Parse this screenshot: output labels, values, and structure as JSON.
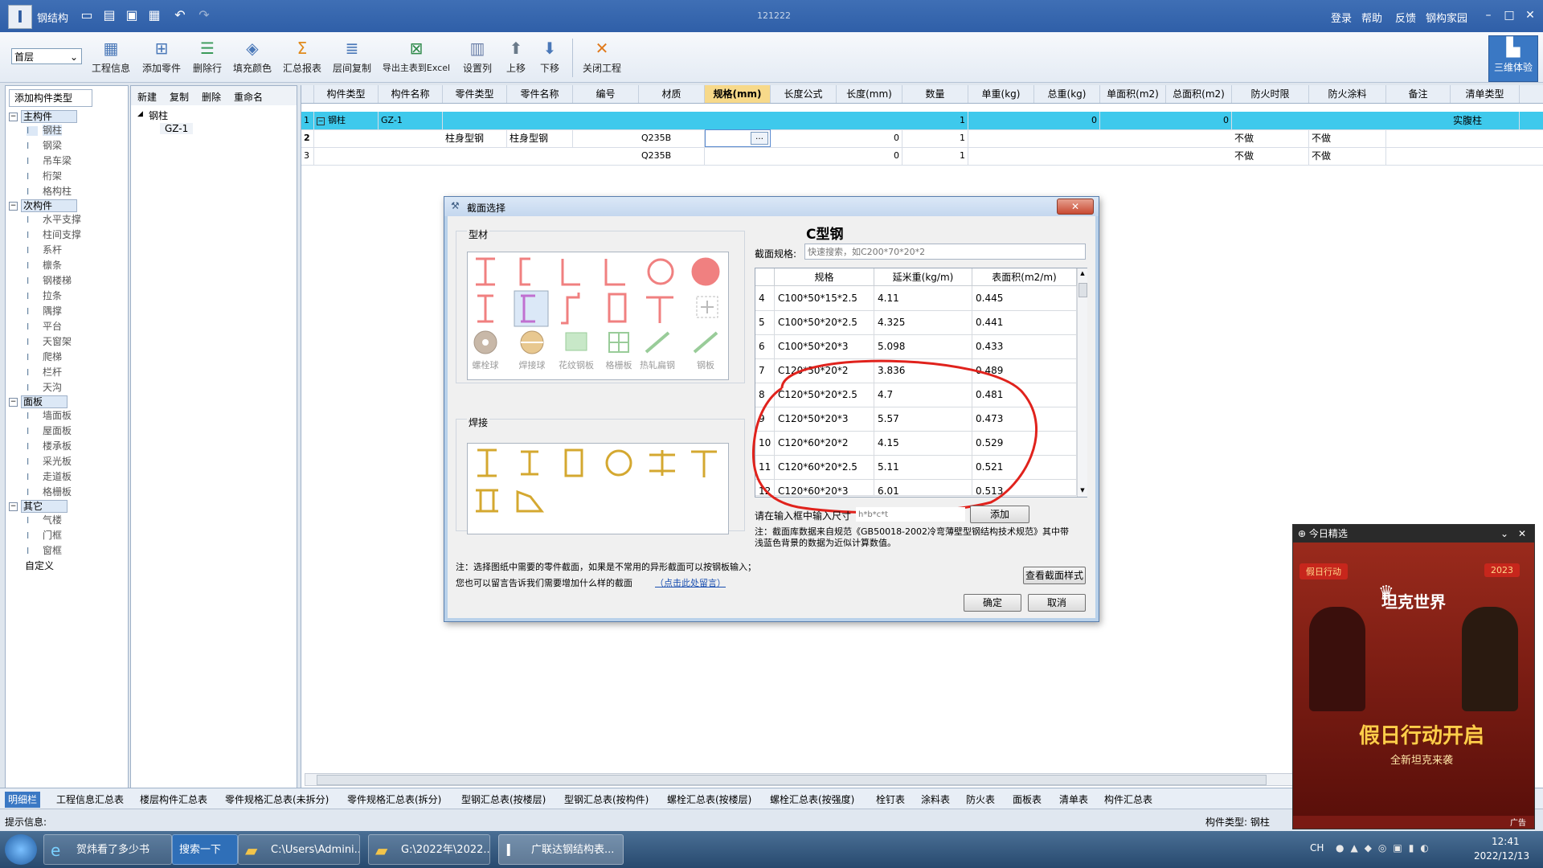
{
  "window": {
    "app_title": "钢结构",
    "center_title": "121222",
    "menu": [
      "登录",
      "帮助",
      "反馈",
      "钢构家园"
    ]
  },
  "ribbon": {
    "floor_select": "首层",
    "buttons": [
      "工程信息",
      "添加零件",
      "删除行",
      "填充颜色",
      "汇总报表",
      "层间复制",
      "导出主表到Excel",
      "设置列",
      "上移",
      "下移",
      "关闭工程"
    ],
    "btn_3d": "三维体验"
  },
  "left_panel": {
    "header": "添加构件类型",
    "groups": [
      {
        "label": "主构件",
        "items": [
          "钢柱",
          "钢梁",
          "吊车梁",
          "桁架",
          "格构柱"
        ]
      },
      {
        "label": "次构件",
        "items": [
          "水平支撑",
          "柱间支撑",
          "系杆",
          "檩条",
          "钢楼梯",
          "拉条",
          "隅撑",
          "平台",
          "天窗架",
          "爬梯",
          "栏杆",
          "天沟"
        ]
      },
      {
        "label": "面板",
        "items": [
          "墙面板",
          "屋面板",
          "楼承板",
          "采光板",
          "走道板",
          "格栅板"
        ]
      },
      {
        "label": "其它",
        "items": [
          "气楼",
          "门框",
          "窗框"
        ]
      }
    ],
    "custom": "自定义"
  },
  "mid_panel": {
    "tools": [
      "新建",
      "复制",
      "删除",
      "重命名"
    ],
    "tree_root": "钢柱",
    "tree_child": "GZ-1"
  },
  "grid": {
    "headers": [
      "构件类型",
      "构件名称",
      "零件类型",
      "零件名称",
      "编号",
      "材质",
      "规格(mm)",
      "长度公式",
      "长度(mm)",
      "数量",
      "单重(kg)",
      "总重(kg)",
      "单面积(m2)",
      "总面积(m2)",
      "防火时限",
      "防火涂料",
      "备注",
      "清单类型"
    ],
    "rows": [
      [
        "1",
        "钢柱",
        "GZ-1",
        "",
        "",
        "",
        "",
        "",
        "",
        "",
        "1",
        "",
        "0",
        "",
        "0",
        "",
        "",
        "",
        "实腹柱"
      ],
      [
        "2",
        "",
        "",
        "柱身型钢",
        "柱身型钢",
        "",
        "Q235B",
        "…",
        "",
        "0",
        "1",
        "",
        "",
        "",
        "",
        "不做",
        "不做",
        "",
        ""
      ],
      [
        "3",
        "",
        "",
        "",
        "",
        "",
        "Q235B",
        "",
        "",
        "0",
        "1",
        "",
        "",
        "",
        "",
        "不做",
        "不做",
        "",
        ""
      ]
    ]
  },
  "dialog": {
    "title": "截面选择",
    "group_profiles": "型材",
    "profile_labels": [
      "螺栓球",
      "焊接球",
      "花纹钢板",
      "格栅板",
      "热轧扁钢",
      "钢板"
    ],
    "group_welded": "焊接",
    "heading": "C型钢",
    "spec_label": "截面规格:",
    "search_placeholder": "快速搜索，如C200*70*20*2",
    "table_headers": [
      "规格",
      "延米重(kg/m)",
      "表面积(m2/m)"
    ],
    "table_rows": [
      [
        "4",
        "C100*50*15*2.5",
        "4.11",
        "0.445"
      ],
      [
        "5",
        "C100*50*20*2.5",
        "4.325",
        "0.441"
      ],
      [
        "6",
        "C100*50*20*3",
        "5.098",
        "0.433"
      ],
      [
        "7",
        "C120*50*20*2",
        "3.836",
        "0.489"
      ],
      [
        "8",
        "C120*50*20*2.5",
        "4.7",
        "0.481"
      ],
      [
        "9",
        "C120*50*20*3",
        "5.57",
        "0.473"
      ],
      [
        "10",
        "C120*60*20*2",
        "4.15",
        "0.529"
      ],
      [
        "11",
        "C120*60*20*2.5",
        "5.11",
        "0.521"
      ],
      [
        "12",
        "C120*60*20*3",
        "6.01",
        "0.513"
      ]
    ],
    "input_label": "请在输入框中输入尺寸",
    "input_placeholder": "h*b*c*t",
    "add_button": "添加",
    "note_right": "注：截面库数据来自规范《GB50018-2002冷弯薄壁型钢结构技术规范》其中带浅蓝色背景的数据为近似计算数值。",
    "note_left_1": "注：选择图纸中需要的零件截面，如果是不常用的异形截面可以按钢板输入；",
    "note_left_2": "您也可以留言告诉我们需要增加什么样的截面",
    "note_link": "（点击此处留言）",
    "view_style_button": "查看截面样式",
    "ok_button": "确定",
    "cancel_button": "取消"
  },
  "bottom_tabs": [
    "明细栏",
    "工程信息汇总表",
    "楼层构件汇总表",
    "零件规格汇总表(未拆分)",
    "零件规格汇总表(拆分)",
    "型钢汇总表(按楼层)",
    "型钢汇总表(按构件)",
    "螺栓汇总表(按楼层)",
    "螺栓汇总表(按强度)",
    "栓钉表",
    "涂料表",
    "防火表",
    "面板表",
    "清单表",
    "构件汇总表"
  ],
  "status": {
    "hint_label": "提示信息:",
    "component_type": "构件类型: 钢柱"
  },
  "ad": {
    "header": "今日精选",
    "badge_left": "假日行动",
    "badge_right": "2023",
    "brand": "坦克世界",
    "headline": "假日行动开启",
    "sub": "全新坦克来袭",
    "ad_tag": "广告"
  },
  "taskbar": {
    "items": [
      "贺炜看了多少书",
      "搜索一下",
      "C:\\Users\\Admini...",
      "G:\\2022年\\2022...",
      "广联达钢结构表..."
    ],
    "lang": "CH",
    "time": "12:41",
    "date": "2022/12/13"
  }
}
